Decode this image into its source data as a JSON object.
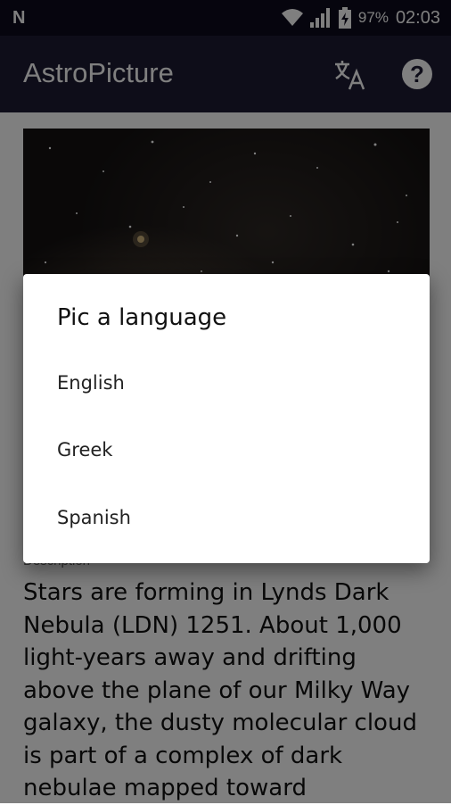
{
  "status_bar": {
    "notification_icon": "n-letter-icon",
    "battery_text": "97%",
    "time": "02:03"
  },
  "app_bar": {
    "title": "AstroPicture",
    "translate_icon": "translate-icon",
    "help_icon": "help-icon",
    "help_glyph": "?"
  },
  "content": {
    "description_label": "Description",
    "description_text": "Stars are forming in Lynds Dark Nebula (LDN) 1251. About 1,000 light-years away and drifting above the plane of our Milky Way galaxy, the dusty molecular cloud is part of a complex of dark nebulae mapped toward"
  },
  "dialog": {
    "title": "Pic a language",
    "options": [
      {
        "label": "English"
      },
      {
        "label": "Greek"
      },
      {
        "label": "Spanish"
      }
    ]
  },
  "colors": {
    "status_bar": "#0c0a1c",
    "app_bar": "#1d1a33",
    "scrim": "rgba(0,0,0,0.5)"
  }
}
